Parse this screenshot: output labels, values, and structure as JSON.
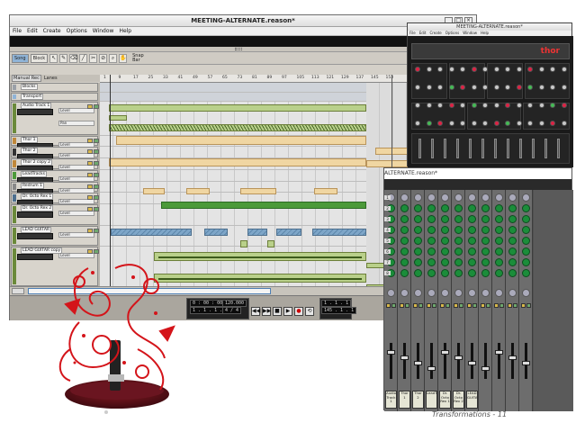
{
  "main_window": {
    "title": "MEETING-ALTERNATE.reason*",
    "window_buttons": [
      "_",
      "□",
      "×"
    ],
    "menu": [
      "File",
      "Edit",
      "Create",
      "Options",
      "Window",
      "Help"
    ]
  },
  "toolbar": {
    "song_label": "Song",
    "block_label": "Block",
    "snap_label": "Snap",
    "snap_value": "Bar"
  },
  "lanes_header": {
    "manual_rec": "Manual Rec",
    "lanes_label": "Lanes"
  },
  "ruler_marks": [
    "1",
    "9",
    "17",
    "25",
    "33",
    "41",
    "49",
    "57",
    "65",
    "73",
    "81",
    "89",
    "97",
    "105",
    "113",
    "121",
    "129",
    "137",
    "145",
    "153"
  ],
  "tracks": [
    {
      "name": "Blocks",
      "color": "#9aa0a8"
    },
    {
      "name": "Transport",
      "color": "#8fb3d6"
    },
    {
      "name": "Audio Track 1",
      "color": "#6a8a3a"
    },
    {
      "name": "Thor 1",
      "color": "#c0883a"
    },
    {
      "name": "Thor 2",
      "color": "#333333"
    },
    {
      "name": "Thor 2 copy 2",
      "color": "#c0883a"
    },
    {
      "name": "LeadTracks",
      "color": "#4c9a3a"
    },
    {
      "name": "Redrum 1",
      "color": "#888888"
    },
    {
      "name": "Dr. Octo Rex 1",
      "color": "#4d6f8e"
    },
    {
      "name": "Dr. Octo Rex 2",
      "color": "#6a8a3a"
    },
    {
      "name": "LEAD GUITAR",
      "color": "#6a8a3a"
    },
    {
      "name": "LEAD GUITAR copy",
      "color": "#6a8a3a"
    }
  ],
  "lane_labels": {
    "level": "Level",
    "pan": "Pan"
  },
  "transport": {
    "time_display": "0 : 00 : 000",
    "bar_display": "1 . 1 . 1 . 0",
    "tempo": "120.000",
    "signature": "4 / 4",
    "left_locator": "1 . 1 . 1",
    "right_locator": "145 . 1 . 1",
    "buttons": [
      "◀◀",
      "▶▶",
      "■",
      "▶",
      "●",
      "⟲"
    ]
  },
  "thor_window": {
    "title": "MEETING-ALTERNATE.reason*",
    "menu": [
      "File",
      "Edit",
      "Create",
      "Options",
      "Window",
      "Help"
    ],
    "logo": "thor"
  },
  "mixer_window": {
    "title": "ALTERNATE.reason*",
    "channels": [
      "Audio Track 1",
      "Thor 1",
      "Thor 2",
      "LeadTracks",
      "Dr. Octo Rex 1",
      "Dr. Octo Rex 2",
      "LEAD GUITAR"
    ],
    "send_numbers": [
      "1",
      "2",
      "3",
      "4",
      "5",
      "6",
      "7",
      "8"
    ]
  },
  "caption": "Transformations - 11",
  "colors": {
    "clip_green": "#b9d08a",
    "clip_tan": "#f0d6a2",
    "clip_blue": "#7ea6c8",
    "mixer_knob": "#1b8d3a",
    "thor_accent": "#e33333",
    "art_red": "#d4141a"
  }
}
